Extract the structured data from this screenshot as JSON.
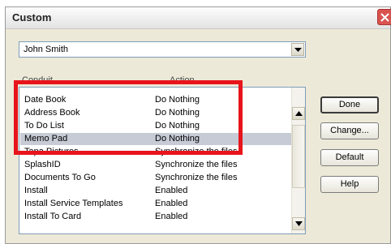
{
  "window": {
    "title": "Custom",
    "close_icon": "close-x-icon"
  },
  "user_select": {
    "value": "John Smith",
    "arrow_icon": "chevron-down-icon"
  },
  "list": {
    "headers": {
      "conduit": "Conduit",
      "action": "Action"
    },
    "rows": [
      {
        "conduit": "Date Book",
        "action": "Do Nothing"
      },
      {
        "conduit": "Address Book",
        "action": "Do Nothing"
      },
      {
        "conduit": "To Do List",
        "action": "Do Nothing"
      },
      {
        "conduit": "Memo Pad",
        "action": "Do Nothing",
        "selected": true
      },
      {
        "conduit": "Tapa Pictures",
        "action": "Synchronize the files"
      },
      {
        "conduit": "SplashID",
        "action": "Synchronize the files"
      },
      {
        "conduit": "Documents To Go",
        "action": "Synchronize the files"
      },
      {
        "conduit": "Install",
        "action": "Enabled"
      },
      {
        "conduit": "Install Service Templates",
        "action": "Enabled"
      },
      {
        "conduit": "Install To Card",
        "action": "Enabled"
      }
    ]
  },
  "buttons": {
    "done": "Done",
    "change": "Change...",
    "default": "Default",
    "help": "Help"
  },
  "annotation": {
    "color": "#e8141b"
  }
}
